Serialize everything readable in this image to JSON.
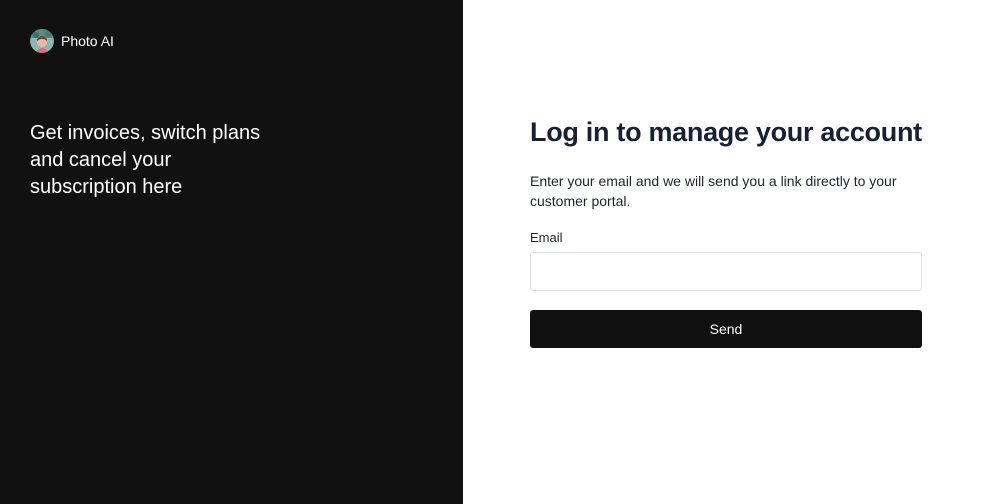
{
  "brand": {
    "name": "Photo AI",
    "avatar_icon": "profile-photo-avatar"
  },
  "left_panel": {
    "tagline": "Get invoices, switch plans and cancel your subscription here",
    "background_color": "#111111"
  },
  "login": {
    "title": "Log in to manage your account",
    "description": "Enter your email and we will send you a link directly to your customer portal.",
    "email_label": "Email",
    "email_value": "",
    "email_placeholder": "",
    "send_label": "Send",
    "button_color": "#111111"
  }
}
